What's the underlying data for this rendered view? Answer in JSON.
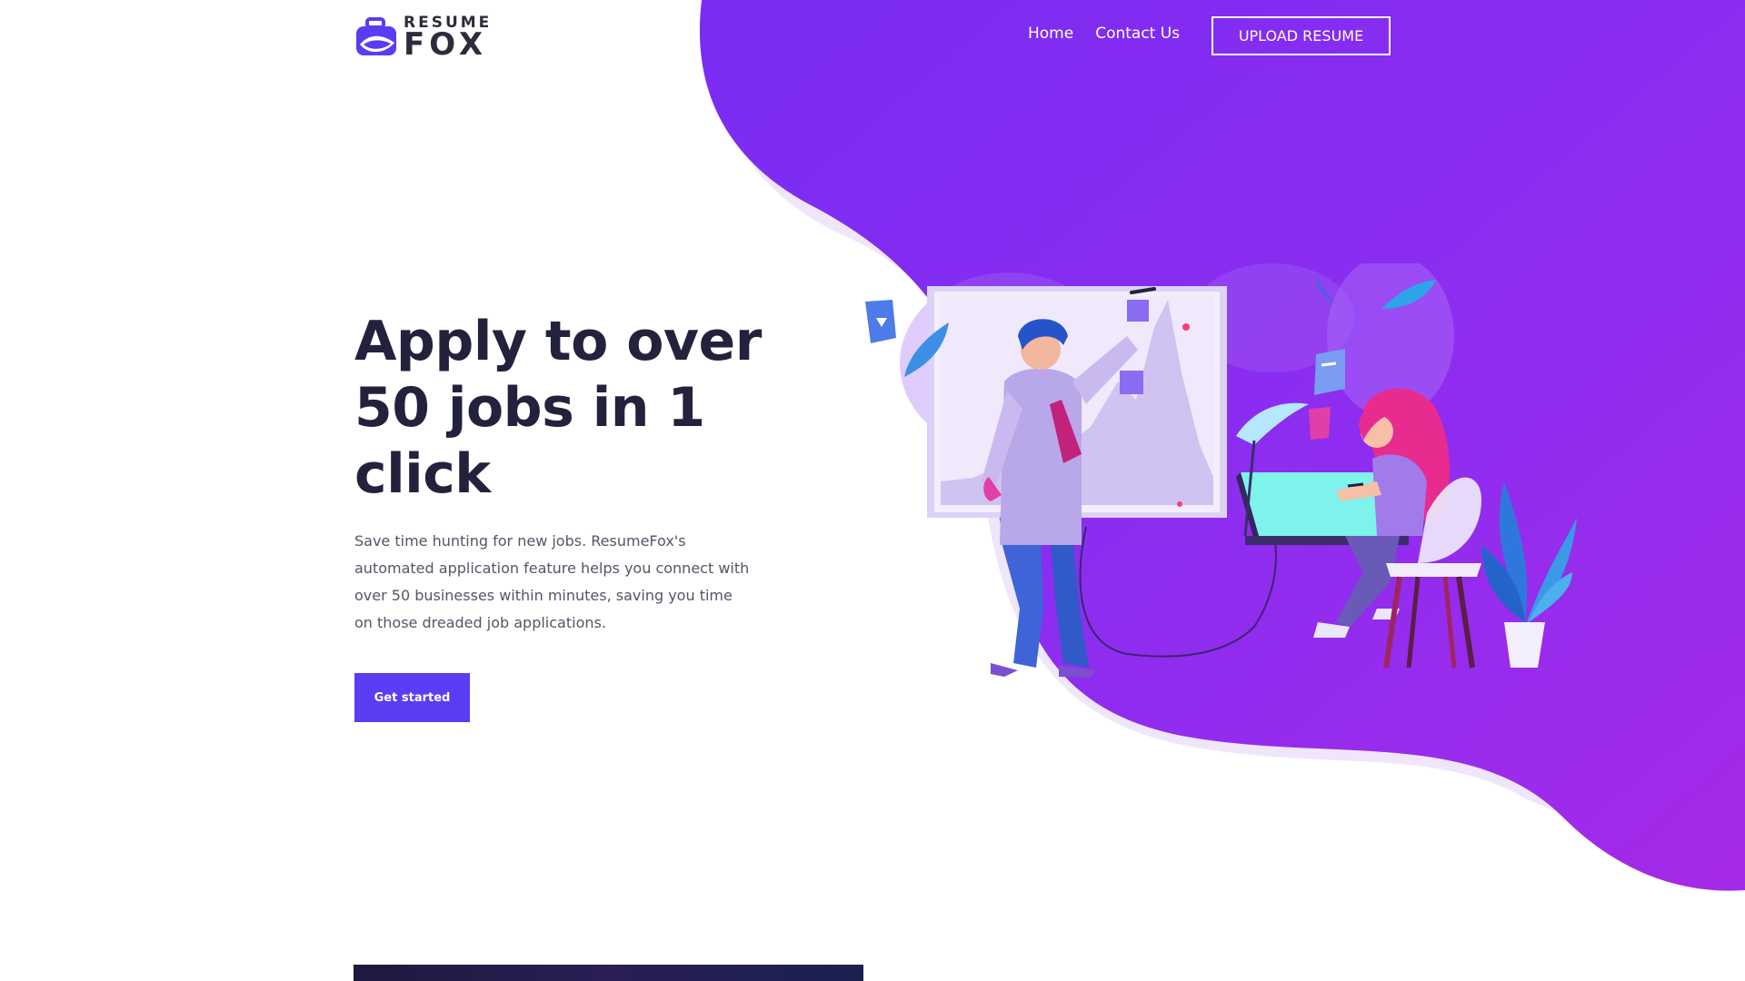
{
  "brand": {
    "logo_top": "RESUME",
    "logo_bottom": "FOX",
    "primary_color": "#5b3cf2",
    "gradient_colors": [
      "#6a2ff5",
      "#a62bf0"
    ]
  },
  "nav": {
    "home": "Home",
    "contact": "Contact Us",
    "upload": "UPLOAD RESUME"
  },
  "hero": {
    "title": "Apply to over 50 jobs in 1 click",
    "description": "Save time hunting for new jobs. ResumeFox's automated application feature helps you connect with over 50 businesses within minutes, saving you time on those dreaded job applications.",
    "cta": "Get started"
  },
  "icons": {
    "logo": "briefcase-icon"
  }
}
